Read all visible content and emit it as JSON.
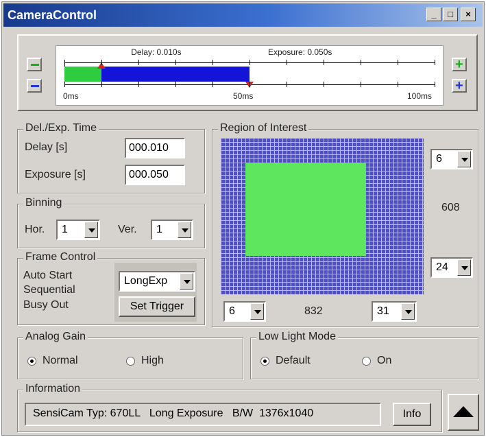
{
  "window": {
    "title": "CameraControl",
    "controls": [
      "_",
      "□",
      "×"
    ]
  },
  "timeline": {
    "delay_label": "Delay: 0.010s",
    "exposure_label": "Exposure: 0.050s",
    "tick_labels": [
      "0ms",
      "50ms",
      "100ms"
    ],
    "delay_ms": 10,
    "exposure_ms": 50,
    "max_ms": 100,
    "colors": {
      "delay": "#2ecc40",
      "exposure": "#1414d8",
      "marker": "#e0201a",
      "minus": "#2233dd",
      "plus_green": "#18b018"
    }
  },
  "del_exp": {
    "legend": "Del./Exp. Time",
    "delay_label": "Delay [s]",
    "delay_value": "000.010",
    "exposure_label": "Exposure [s]",
    "exposure_value": "000.050"
  },
  "binning": {
    "legend": "Binning",
    "hor_label": "Hor.",
    "hor_value": "1",
    "ver_label": "Ver.",
    "ver_value": "1"
  },
  "frame_control": {
    "legend": "Frame Control",
    "items": [
      "Auto Start",
      "Sequential",
      "Busy Out"
    ],
    "mode_value": "LongExp",
    "trigger_label": "Set Trigger"
  },
  "roi": {
    "legend": "Region of Interest",
    "top_value": "6",
    "height_label": "608",
    "bottom_value": "24",
    "left_value": "6",
    "width_label": "832",
    "right_value": "31",
    "colors": {
      "grid": "#4f4fc7",
      "grid_line": "#b9b9f0",
      "selection": "#5ee65e"
    }
  },
  "analog_gain": {
    "legend": "Analog Gain",
    "normal_label": "Normal",
    "high_label": "High",
    "selected": "Normal"
  },
  "low_light": {
    "legend": "Low Light Mode",
    "default_label": "Default",
    "on_label": "On",
    "selected": "Default"
  },
  "information": {
    "legend": "Information",
    "text": "SensiCam Typ: 670LL   Long Exposure   B/W  1376x1040",
    "info_button": "Info"
  }
}
